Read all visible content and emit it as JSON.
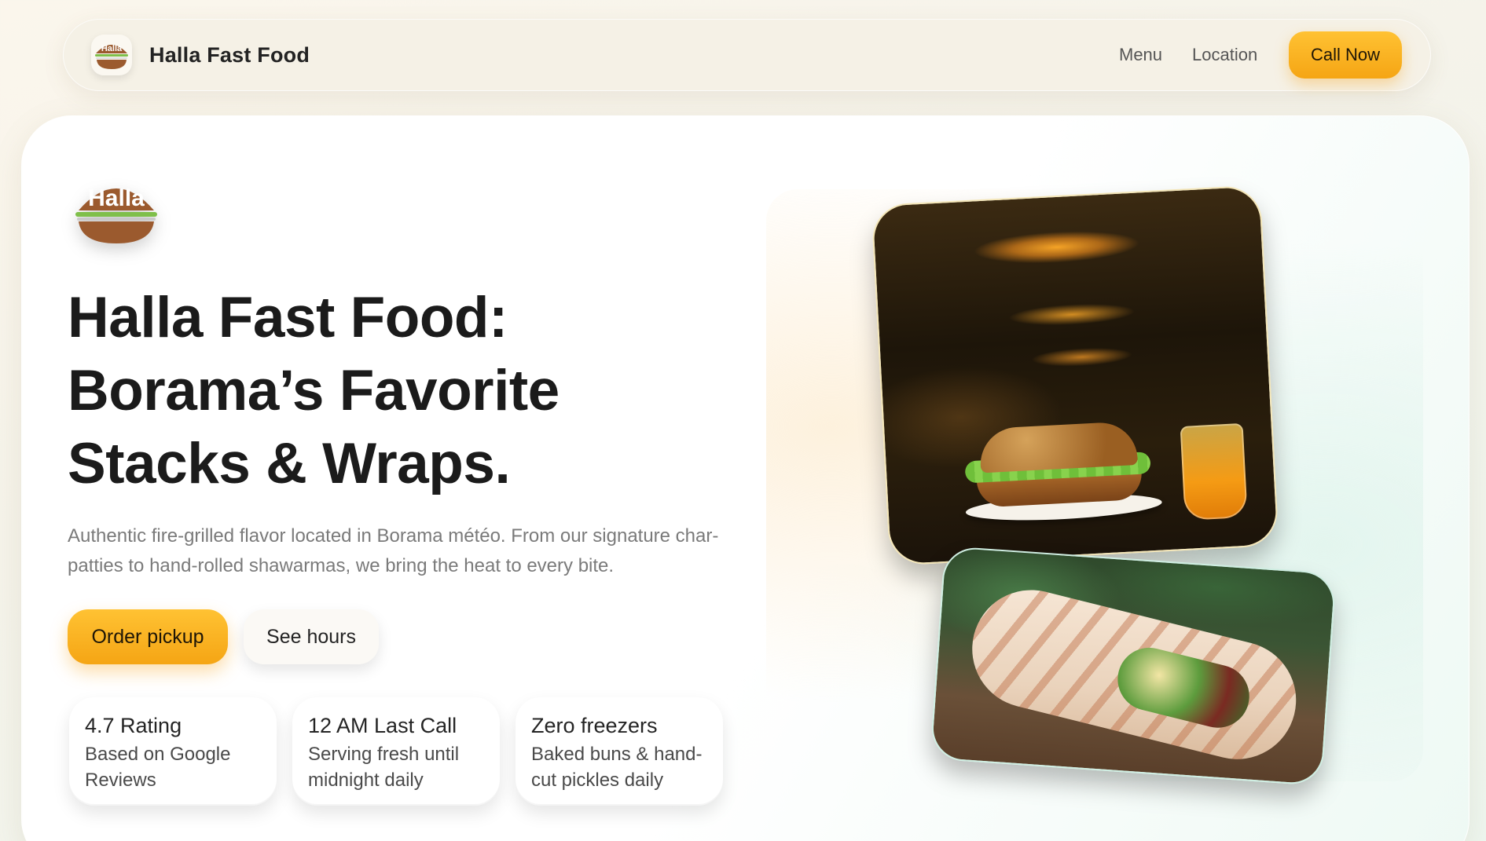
{
  "nav": {
    "brand": "Halla Fast Food",
    "logo_text": "Halla",
    "links": [
      "Menu",
      "Location"
    ],
    "cta": "Call Now"
  },
  "hero": {
    "logo_text": "Halla",
    "headline": [
      "Halla Fast Food:",
      "Borama’s Favorite",
      "Stacks & Wraps."
    ],
    "subcopy": "Authentic fire-grilled flavor located in Borama météo. From our signature char-patties to hand-rolled shawarmas, we bring the heat to every bite.",
    "primary_button": "Order pickup",
    "secondary_button": "See hours",
    "stats": [
      {
        "title": "4.7 Rating",
        "desc": "Based on Google Reviews"
      },
      {
        "title": "12 AM Last Call",
        "desc": "Serving fresh until midnight daily"
      },
      {
        "title": "Zero freezers",
        "desc": "Baked buns & hand-cut pickles daily"
      }
    ]
  },
  "images": [
    {
      "icon": "burger-and-juice-photo"
    },
    {
      "icon": "shawarma-wrap-photo"
    }
  ],
  "colors": {
    "accent": "#f5a514",
    "accent_light": "#ffc233",
    "logo_brown": "#9b5a2e",
    "text_dark": "#1b1b1b",
    "text_muted": "#7a7a7a"
  }
}
